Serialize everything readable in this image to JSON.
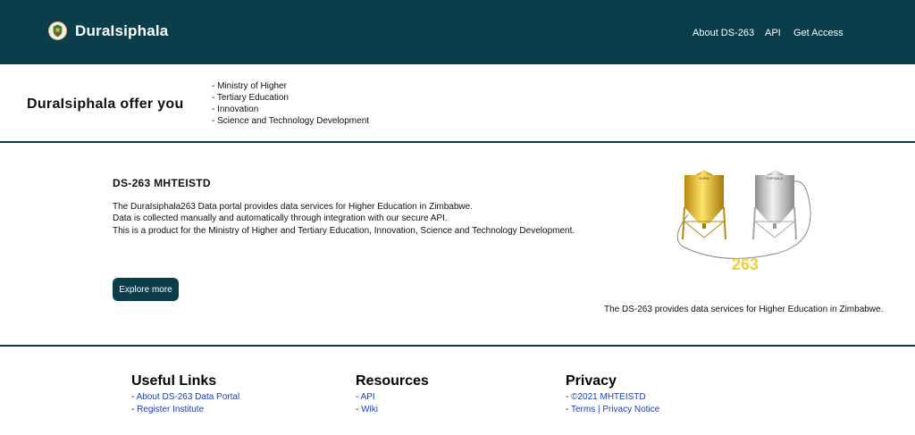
{
  "header": {
    "brand": "DuraIsiphala",
    "logo_icon": "coat-of-arms-icon",
    "nav": [
      {
        "label": "About DS-263"
      },
      {
        "label": "API"
      },
      {
        "label": "Get Access"
      }
    ]
  },
  "offer": {
    "title": "DuraIsiphala offer you",
    "items": [
      "- Ministry of Higher",
      "- Tertiary Education",
      "- Innovation",
      "- Science and Technology Development"
    ]
  },
  "main": {
    "heading": "DS-263 MHTEISTD",
    "description": [
      "The DuraIsiphala263 Data portal provides data services for Higher Education in Zimbabwe.",
      "Data is collected manually and automatically through integration with our secure API.",
      "This is a product for the Ministry of Higher and Tertiary Education, Innovation, Science and Technology Development."
    ],
    "explore_label": "Explore more",
    "hero": {
      "left_silo_label": "DURA",
      "right_silo_label": "ISIPHALA",
      "number": "263"
    },
    "caption": "The DS-263 provides data services for Higher Education in Zimbabwe."
  },
  "footer": {
    "useful_links": {
      "title": "Useful Links",
      "links": [
        "About DS-263 Data Portal",
        "Register Institute"
      ]
    },
    "resources": {
      "title": "Resources",
      "links": [
        "API",
        "Wiki"
      ]
    },
    "privacy": {
      "title": "Privacy",
      "links": [
        "©2021 MHTEISTD",
        "Terms | Privacy Notice"
      ]
    }
  },
  "colors": {
    "primary": "#0b3d4b",
    "link": "#1d3fb8",
    "gold": "#e1b827",
    "silver": "#bfbfbf"
  }
}
